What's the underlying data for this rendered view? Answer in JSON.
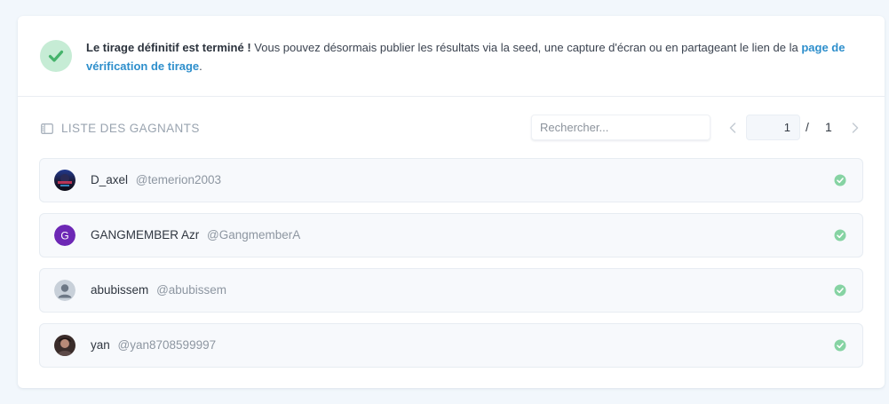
{
  "notice": {
    "strong": "Le tirage définitif est terminé !",
    "text": "Vous pouvez désormais publier les résultats via la seed, une capture d'écran ou en partageant le lien de la",
    "link": "page de vérification de tirage",
    "end": "."
  },
  "list": {
    "title": "LISTE DES GAGNANTS",
    "search_placeholder": "Rechercher...",
    "current_page": "1",
    "separator": "/",
    "total_pages": "1"
  },
  "winners": [
    {
      "name": "D_axel",
      "handle": "@temerion2003",
      "avatar": "photo-dark"
    },
    {
      "name": "GANGMEMBER Azr",
      "handle": "@GangmemberA",
      "avatar": "letter",
      "initial": "G",
      "color": "#6d28b5"
    },
    {
      "name": "abubissem",
      "handle": "@abubissem",
      "avatar": "default-user"
    },
    {
      "name": "yan",
      "handle": "@yan8708599997",
      "avatar": "photo-person"
    }
  ],
  "colors": {
    "accent": "#2e8fcc",
    "success": "#45b36b",
    "success_bg": "#c6ecd5"
  }
}
